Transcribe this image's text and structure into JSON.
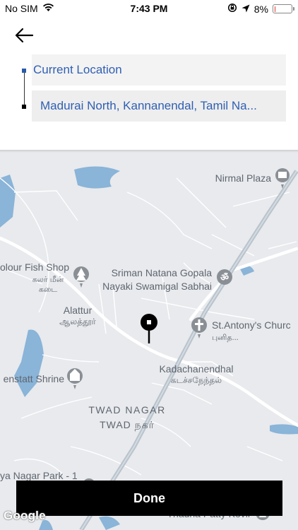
{
  "status_bar": {
    "carrier": "No SIM",
    "time": "7:43 PM",
    "battery": "8%",
    "battery_level": 0.08,
    "battery_color": "#e0362c",
    "icons": [
      "wifi-icon",
      "rotation-lock-icon",
      "location-arrow-icon",
      "battery-icon"
    ]
  },
  "header": {
    "back_icon": "arrow-left-icon",
    "pickup": "Current Location",
    "destination": "Madurai North, Kannanendal, Tamil Na..."
  },
  "map": {
    "labels": {
      "nirmal_plaza": "Nirmal Plaza",
      "fish_shop": "olour Fish Shop",
      "fish_shop_tamil_1": "கலர் மீன்",
      "fish_shop_tamil_2": "கடை",
      "sabhai_1": "Sriman Natana Gopala",
      "sabhai_2": "Nayaki Swamigal Sabhai",
      "alattur": "Alattur",
      "alattur_tamil": "ஆலத்தூர்",
      "church": "St.Antony's Churc",
      "church_tamil": "புனித...",
      "kadachanendhal": "Kadachanendhal",
      "kadachanendhal_tamil": "கடச்சநேந்தல்",
      "shrine": "enstatt Shrine",
      "twad_nagar": "TWAD NAGAR",
      "twad_nagar_tamil": "TWAD நகர்",
      "park": "ya Nagar Park - 1",
      "kovil": "Thadha Patty Kovil"
    },
    "colors": {
      "land": "#e8eaed",
      "water": "#8ab4d8",
      "road": "#ffffff",
      "rail": "#b9c3cc",
      "poi_icon": "#8a8f95"
    }
  },
  "done_label": "Done",
  "attribution": "Google"
}
